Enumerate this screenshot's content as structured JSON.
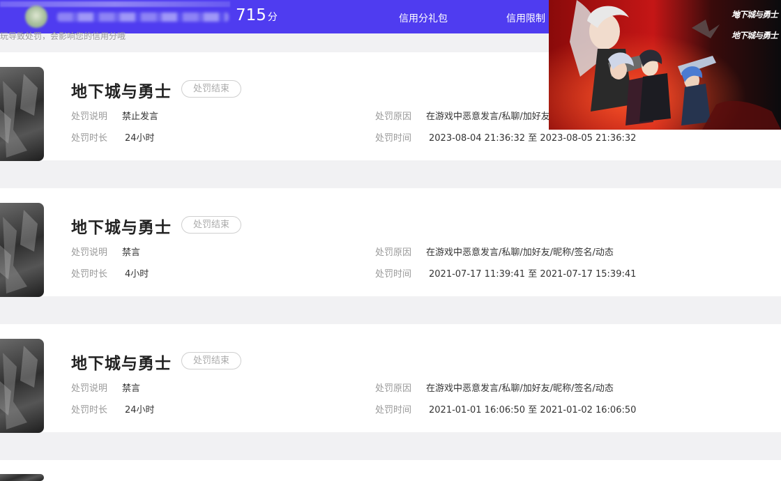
{
  "header": {
    "score": "715",
    "score_unit": "分",
    "nav": [
      {
        "label": "信用分礼包"
      },
      {
        "label": "信用限制"
      }
    ]
  },
  "subnote": "玩导致处罚，会影响您的信用分哦",
  "records": [
    {
      "game": "地下城与勇士",
      "status": "处罚结束",
      "desc_label": "处罚说明",
      "desc": "禁止发言",
      "duration_label": "处罚时长",
      "duration": "24小时",
      "reason_label": "处罚原因",
      "reason": "在游戏中恶意发言/私聊/加好友/昵称/签名/动态",
      "time_label": "处罚时间",
      "time": "2023-08-04 21:36:32 至 2023-08-05 21:36:32"
    },
    {
      "game": "地下城与勇士",
      "status": "处罚结束",
      "desc_label": "处罚说明",
      "desc": "禁言",
      "duration_label": "处罚时长",
      "duration": "4小时",
      "reason_label": "处罚原因",
      "reason": "在游戏中恶意发言/私聊/加好友/昵称/签名/动态",
      "time_label": "处罚时间",
      "time": "2021-07-17 11:39:41 至 2021-07-17 15:39:41"
    },
    {
      "game": "地下城与勇士",
      "status": "处罚结束",
      "desc_label": "处罚说明",
      "desc": "禁言",
      "duration_label": "处罚时长",
      "duration": "24小时",
      "reason_label": "处罚原因",
      "reason": "在游戏中恶意发言/私聊/加好友/昵称/签名/动态",
      "time_label": "处罚时间",
      "time": "2021-01-01 16:06:50 至 2021-01-02 16:06:50"
    }
  ],
  "popup": {
    "logo_text": "地下城与勇士"
  }
}
